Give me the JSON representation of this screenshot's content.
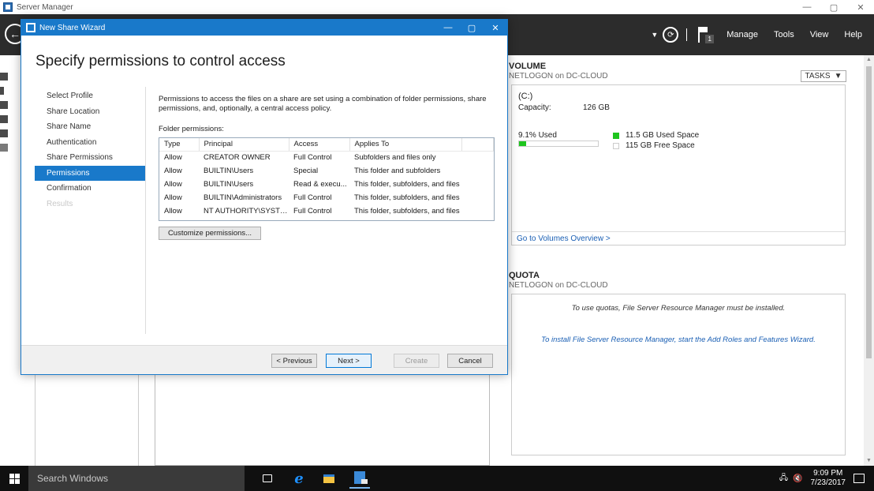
{
  "server_manager": {
    "title": "Server Manager",
    "window_controls": [
      "—",
      "▢",
      "✕"
    ],
    "header": {
      "notification_count": "1",
      "menu": [
        "Manage",
        "Tools",
        "View",
        "Help"
      ]
    },
    "volume": {
      "title": "VOLUME",
      "subtitle": "NETLOGON on DC-CLOUD",
      "tasks_label": "TASKS",
      "drive": "(C:)",
      "capacity_label": "Capacity:",
      "capacity_value": "126 GB",
      "used_percent": "9.1% Used",
      "used_fraction": 0.091,
      "used_space": "11.5 GB Used Space",
      "free_space": "115 GB Free Space",
      "used_color": "#1ec51e",
      "goto_link": "Go to Volumes Overview >"
    },
    "quota": {
      "title": "QUOTA",
      "subtitle": "NETLOGON on DC-CLOUD",
      "message": "To use quotas, File Server Resource Manager must be installed.",
      "install_link": "To install File Server Resource Manager, start the Add Roles and Features Wizard."
    }
  },
  "wizard": {
    "title": "New Share Wizard",
    "heading": "Specify permissions to control access",
    "steps": [
      {
        "label": "Select Profile",
        "state": "normal"
      },
      {
        "label": "Share Location",
        "state": "normal"
      },
      {
        "label": "Share Name",
        "state": "normal"
      },
      {
        "label": "Authentication",
        "state": "normal"
      },
      {
        "label": "Share Permissions",
        "state": "normal"
      },
      {
        "label": "Permissions",
        "state": "active"
      },
      {
        "label": "Confirmation",
        "state": "normal"
      },
      {
        "label": "Results",
        "state": "disabled"
      }
    ],
    "description": "Permissions to access the files on a share are set using a combination of folder permissions, share permissions, and, optionally, a central access policy.",
    "folder_permissions_label": "Folder permissions:",
    "table": {
      "columns": [
        "Type",
        "Principal",
        "Access",
        "Applies To"
      ],
      "rows": [
        [
          "Allow",
          "CREATOR OWNER",
          "Full Control",
          "Subfolders and files only"
        ],
        [
          "Allow",
          "BUILTIN\\Users",
          "Special",
          "This folder and subfolders"
        ],
        [
          "Allow",
          "BUILTIN\\Users",
          "Read & execu...",
          "This folder, subfolders, and files"
        ],
        [
          "Allow",
          "BUILTIN\\Administrators",
          "Full Control",
          "This folder, subfolders, and files"
        ],
        [
          "Allow",
          "NT AUTHORITY\\SYSTEM",
          "Full Control",
          "This folder, subfolders, and files"
        ]
      ]
    },
    "customize_button": "Customize permissions...",
    "buttons": {
      "previous": "< Previous",
      "next": "Next >",
      "create": "Create",
      "cancel": "Cancel"
    },
    "accent_color": "#1979ca"
  },
  "taskbar": {
    "search_placeholder": "Search Windows",
    "time": "9:09 PM",
    "date": "7/23/2017"
  }
}
